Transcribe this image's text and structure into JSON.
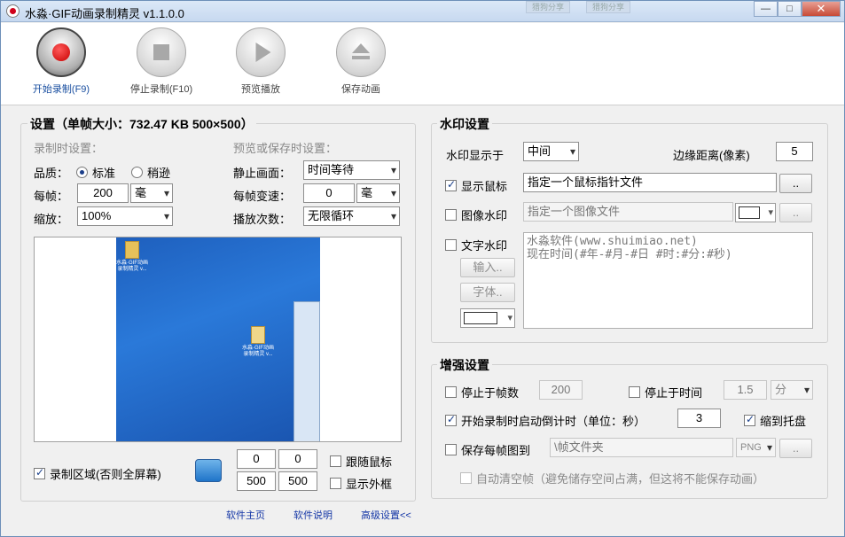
{
  "window": {
    "title": "水淼·GIF动画录制精灵 v1.1.0.0",
    "ghost_buttons": [
      "猎狗分享",
      "猎狗分享"
    ],
    "controls": {
      "minimize": "—",
      "maximize": "□",
      "close": "✕"
    }
  },
  "toolbar": {
    "start": "开始录制(F9)",
    "stop": "停止录制(F10)",
    "play": "预览播放",
    "save": "保存动画"
  },
  "settings": {
    "title": "设置（单帧大小：732.47 KB 500×500）",
    "record_header": "录制时设置：",
    "preview_header": "预览或保存时设置：",
    "quality_label": "品质：",
    "quality_standard": "标准",
    "quality_sparse": "稍逊",
    "per_frame_label": "每帧：",
    "per_frame_value": "200",
    "per_frame_unit": "毫",
    "zoom_label": "缩放：",
    "zoom_value": "100%",
    "still_label": "静止画面：",
    "still_value": "时间等待",
    "speed_label": "每帧变速：",
    "speed_value": "0",
    "speed_unit": "毫",
    "loop_label": "播放次数：",
    "loop_value": "无限循环",
    "region_label": "录制区域(否则全屏幕)",
    "region_x": "0",
    "region_y": "0",
    "region_w": "500",
    "region_h": "500",
    "follow_mouse": "跟随鼠标",
    "show_frame": "显示外框",
    "desktop_icon_1": "水淼·GIF动画录制精灵 v...",
    "desktop_icon_2": "水淼·GIF动画录制精灵 v..."
  },
  "watermark": {
    "title": "水印设置",
    "display_label": "水印显示于",
    "display_value": "中间",
    "margin_label": "边缘距离(像素)",
    "margin_value": "5",
    "show_cursor": "显示鼠标",
    "cursor_file": "指定一个鼠标指针文件",
    "image_wm": "图像水印",
    "image_file": "指定一个图像文件",
    "text_wm": "文字水印",
    "input_btn": "输入..",
    "font_btn": "字体..",
    "browse": "..",
    "text_line1": "水淼软件(www.shuimiao.net)",
    "text_line2": "现在时间(#年-#月-#日 #时:#分:#秒)"
  },
  "enhance": {
    "title": "增强设置",
    "stop_at_frames": "停止于帧数",
    "frames_value": "200",
    "stop_at_time": "停止于时间",
    "time_value": "1.5",
    "time_unit": "分",
    "countdown": "开始录制时启动倒计时（单位：秒）",
    "countdown_value": "3",
    "minimize_tray": "缩到托盘",
    "save_each": "保存每帧图到",
    "folder_value": "\\帧文件夹",
    "format_value": "PNG",
    "browse": "..",
    "auto_clear": "自动清空帧（避免储存空间占满，但这将不能保存动画）"
  },
  "footer": {
    "home": "软件主页",
    "help": "软件说明",
    "advanced": "高级设置<<"
  }
}
